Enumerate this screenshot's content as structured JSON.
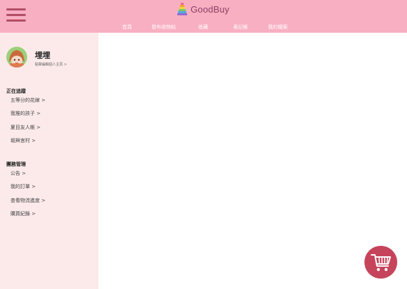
{
  "brand": {
    "name": "GoodBuy",
    "logo_icon": "stacked-rainbow-logo-icon"
  },
  "menu_icon": "hamburger-menu-icon",
  "nav": [
    {
      "label": "首頁"
    },
    {
      "label": "發布收物帖"
    },
    {
      "label": "收藏"
    },
    {
      "label": "表記帳"
    },
    {
      "label": "我的檔案"
    }
  ],
  "profile": {
    "name": "埋埋",
    "edit_label": "點擊編輯個人主頁 >",
    "avatar_icon": "anime-girl-avatar"
  },
  "following": {
    "title": "正在追蹤",
    "items": [
      "五等分的花嫁 >",
      "我推的孩子 >",
      "夏目友人帳 >",
      "堀與宮村 >"
    ]
  },
  "group_admin": {
    "title": "團務管理",
    "items": [
      "公告 >",
      "我的訂單 >",
      "查看物流進度 >",
      "購買紀錄 >"
    ]
  },
  "cart": {
    "icon": "shopping-cart-icon"
  },
  "colors": {
    "header": "#f8afc1",
    "sidebar": "#fceaea",
    "cart_button": "#c6445b",
    "hamburger": "#b34d66",
    "brand_text": "#8a3e63"
  }
}
